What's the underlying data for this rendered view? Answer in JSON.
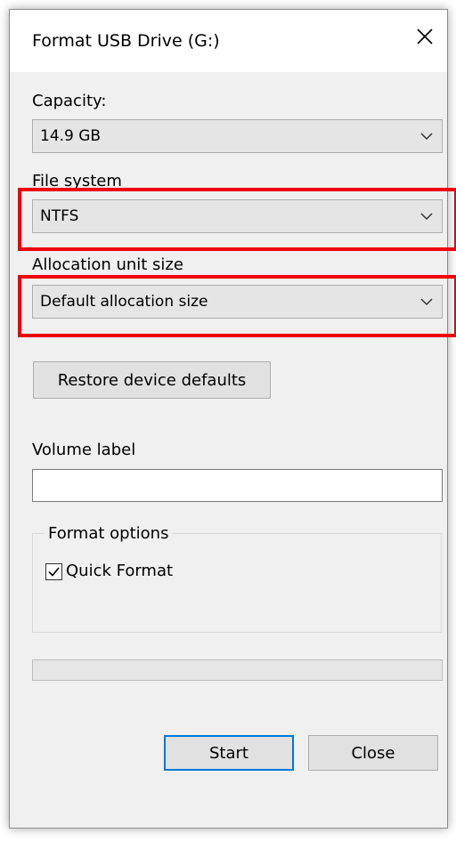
{
  "dialog": {
    "title": "Format USB Drive (G:)",
    "close_glyph": "X"
  },
  "capacity": {
    "label": "Capacity:",
    "value": "14.9 GB"
  },
  "file_system": {
    "label": "File system",
    "value": "NTFS"
  },
  "allocation": {
    "label": "Allocation unit size",
    "value": "Default allocation size"
  },
  "restore_button": "Restore device defaults",
  "volume_label": {
    "label": "Volume label",
    "value": ""
  },
  "format_options": {
    "legend": "Format options",
    "quick_format_label": "Quick Format",
    "quick_format_checked": true
  },
  "progress": {
    "value": 0
  },
  "buttons": {
    "start": "Start",
    "close": "Close"
  },
  "colors": {
    "highlight": "#ee0000",
    "default_button_border": "#0078d7",
    "dialog_background": "#f0f0f0"
  }
}
